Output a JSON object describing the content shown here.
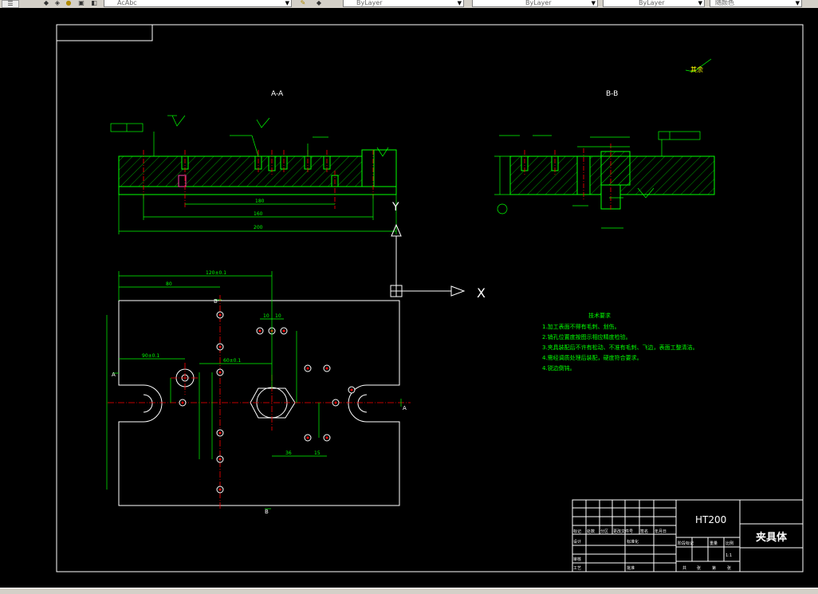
{
  "toolbar": {
    "style_combo": "AcAbc",
    "linetype_combo": "ByLayer",
    "lineweight_combo": "ByLayer",
    "plotstyle_combo": "ByLayer",
    "color_combo": "随颜色"
  },
  "drawing": {
    "section_aa": "A-A",
    "section_bb": "B-B",
    "roughness_rest": "其余",
    "ucs_x": "X",
    "ucs_y": "Y",
    "dims_top": [
      "180",
      "160",
      "200"
    ],
    "dims_plan": [
      "120±0.1",
      "80",
      "10",
      "10",
      "90±0.1",
      "60±0.1",
      "36",
      "15"
    ],
    "view_markers": [
      "A",
      "A",
      "B",
      "B"
    ],
    "tech_req_title": "技术要求",
    "tech_req": [
      "1.加工表面不得有毛刺、划伤。",
      "2.销孔位置度按图示相应精度检验。",
      "3.夹具装配后不许有松动、不准有毛刺、飞边，表面工整清洁。",
      "4.需经调质处理后装配，硬度符合要求。",
      "4.锐边倒钝。"
    ]
  },
  "title_block": {
    "material": "HT200",
    "part_name": "夹具体",
    "scale": "1:1",
    "row_labels": [
      "标记",
      "处数",
      "分区",
      "更改文件号",
      "签名",
      "年月日"
    ],
    "role_labels": [
      "设计",
      "标准化",
      "审核",
      "工艺",
      "批准"
    ],
    "stage_labels": [
      "阶段标记",
      "重量",
      "比例"
    ],
    "sheet_labels": [
      "共",
      "张",
      "第",
      "张"
    ]
  }
}
